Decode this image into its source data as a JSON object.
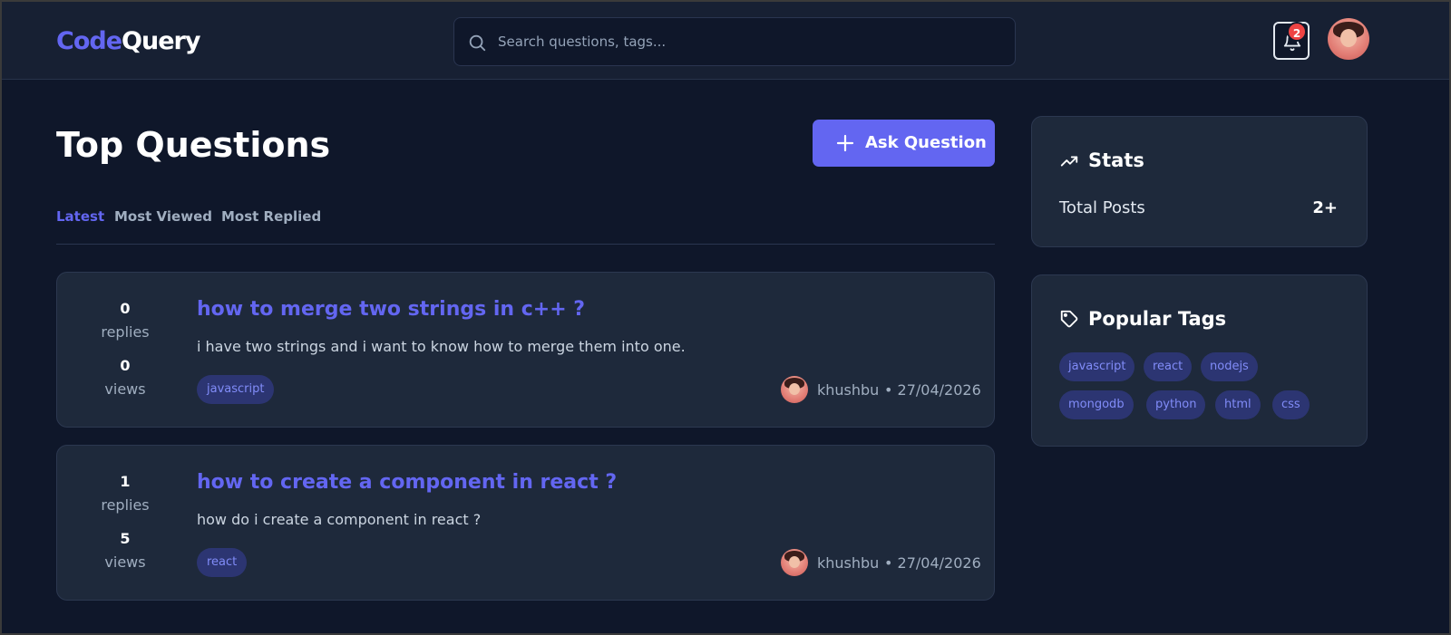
{
  "header": {
    "logo_part1": "Code",
    "logo_part2": "Query",
    "search_placeholder": "Search questions, tags...",
    "notification_count": "2"
  },
  "main": {
    "title": "Top Questions",
    "ask_button_label": "Ask Question",
    "tabs": [
      {
        "label": "Latest",
        "active": true
      },
      {
        "label": "Most Viewed",
        "active": false
      },
      {
        "label": "Most Replied",
        "active": false
      }
    ],
    "questions": [
      {
        "replies": "0",
        "replies_label": "replies",
        "views": "0",
        "views_label": "views",
        "title": "how to merge two strings in c++ ?",
        "body": "i have two strings and i want to know how to merge them into one.",
        "tag": "javascript",
        "author": "khushbu",
        "date": "• 27/04/2026"
      },
      {
        "replies": "1",
        "replies_label": "replies",
        "views": "5",
        "views_label": "views",
        "title": "how to create a component in react ?",
        "body": "how do i create a component in react ?",
        "tag": "react",
        "author": "khushbu",
        "date": "• 27/04/2026"
      }
    ]
  },
  "sidebar": {
    "stats": {
      "title": "Stats",
      "total_posts_label": "Total Posts",
      "total_posts_value": "2+"
    },
    "popular_tags": {
      "title": "Popular Tags",
      "tags": [
        "javascript",
        "react",
        "nodejs",
        "mongodb",
        "python",
        "html",
        "css"
      ]
    }
  },
  "colors": {
    "accent": "#6366f1",
    "background": "#0f172a",
    "card": "#1e293b",
    "badge": "#ef4444"
  }
}
